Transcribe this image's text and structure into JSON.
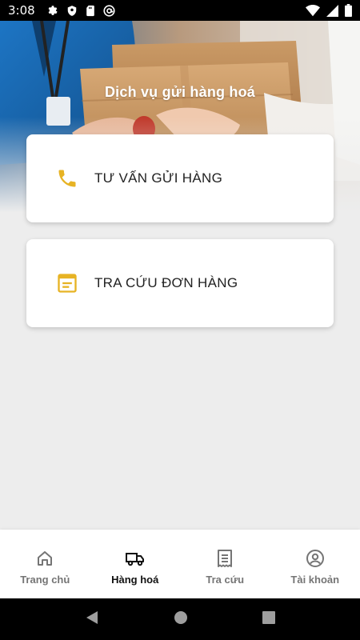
{
  "status_bar": {
    "time": "3:08",
    "left_icons": [
      "gear-icon",
      "shield-icon",
      "sd-card-icon",
      "at-sign-icon"
    ],
    "right_icons": [
      "wifi-icon",
      "signal-icon",
      "battery-icon"
    ]
  },
  "hero": {
    "title": "Dịch vụ gửi hàng hoá"
  },
  "cards": [
    {
      "label": "TƯ VẤN GỬI HÀNG",
      "icon": "phone-icon",
      "icon_color": "#e7b324"
    },
    {
      "label": "TRA CỨU ĐƠN HÀNG",
      "icon": "document-icon",
      "icon_color": "#e7b324"
    }
  ],
  "bottom_nav": {
    "items": [
      {
        "label": "Trang chủ",
        "icon": "home-icon",
        "active": false
      },
      {
        "label": "Hàng hoá",
        "icon": "truck-icon",
        "active": true
      },
      {
        "label": "Tra cứu",
        "icon": "receipt-icon",
        "active": false
      },
      {
        "label": "Tài khoản",
        "icon": "account-icon",
        "active": false
      }
    ]
  },
  "system_nav": {
    "buttons": [
      "back-icon",
      "home-circle-icon",
      "recents-icon"
    ]
  },
  "colors": {
    "accent": "#e7b324",
    "background": "#ededed",
    "nav_active": "#111111",
    "nav_inactive": "#757575"
  }
}
